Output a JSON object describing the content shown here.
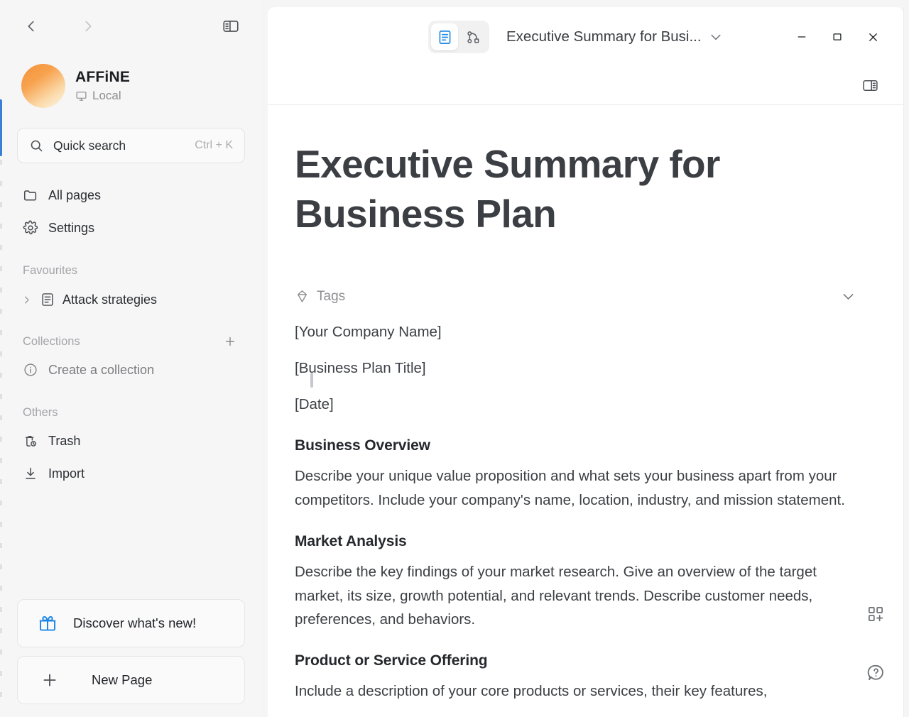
{
  "window": {
    "minimize_label": "Minimize",
    "maximize_label": "Maximize",
    "close_label": "Close"
  },
  "titlebar": {
    "doc_title": "Executive Summary for Busi...",
    "mode_page_label": "Page mode",
    "mode_edgeless_label": "Edgeless mode",
    "right_panel_label": "Toggle right sidebar"
  },
  "sidebar": {
    "nav": {
      "back_label": "Go back",
      "forward_label": "Go forward",
      "collapse_label": "Collapse sidebar"
    },
    "workspace": {
      "name": "AFFiNE",
      "status": "Local"
    },
    "search": {
      "label": "Quick search",
      "shortcut": "Ctrl + K"
    },
    "nav_items": [
      {
        "label": "All pages",
        "icon": "folder-icon"
      },
      {
        "label": "Settings",
        "icon": "gear-icon"
      }
    ],
    "favourites": {
      "title": "Favourites",
      "items": [
        {
          "label": "Attack strategies",
          "icon": "doc-icon"
        }
      ]
    },
    "collections": {
      "title": "Collections",
      "add_label": "New collection",
      "empty_label": "Create a collection"
    },
    "others": {
      "title": "Others",
      "items": [
        {
          "label": "Trash",
          "icon": "trash-icon"
        },
        {
          "label": "Import",
          "icon": "import-icon"
        }
      ]
    },
    "bottom": {
      "discover_label": "Discover what's new!",
      "new_page_label": "New Page"
    }
  },
  "document": {
    "title": "Executive Summary for Business Plan",
    "tags_label": "Tags",
    "placeholders": [
      "[Your Company Name]",
      "[Business Plan Title]",
      "[Date]"
    ],
    "sections": [
      {
        "heading": "Business Overview",
        "body": "Describe your unique value proposition and what sets your business apart from your competitors. Include your company's name, location, industry, and mission statement."
      },
      {
        "heading": "Market Analysis",
        "body": "Describe the key findings of your market research. Give an overview of the target market, its size, growth potential, and relevant trends. Describe customer needs, preferences, and behaviors."
      },
      {
        "heading": "Product or Service Offering",
        "body": "Include a description of your core products or services, their key features,"
      }
    ],
    "floating": {
      "add_widget_label": "Add widget",
      "help_label": "Help"
    }
  },
  "colors": {
    "accent_blue": "#1e88e5",
    "app_background": "#f5f5f5",
    "card_background": "#ffffff",
    "avatar_gradient_start": "#f6913b",
    "avatar_gradient_end": "#fdf6ec",
    "edge_accent": "#3a7fd5"
  }
}
